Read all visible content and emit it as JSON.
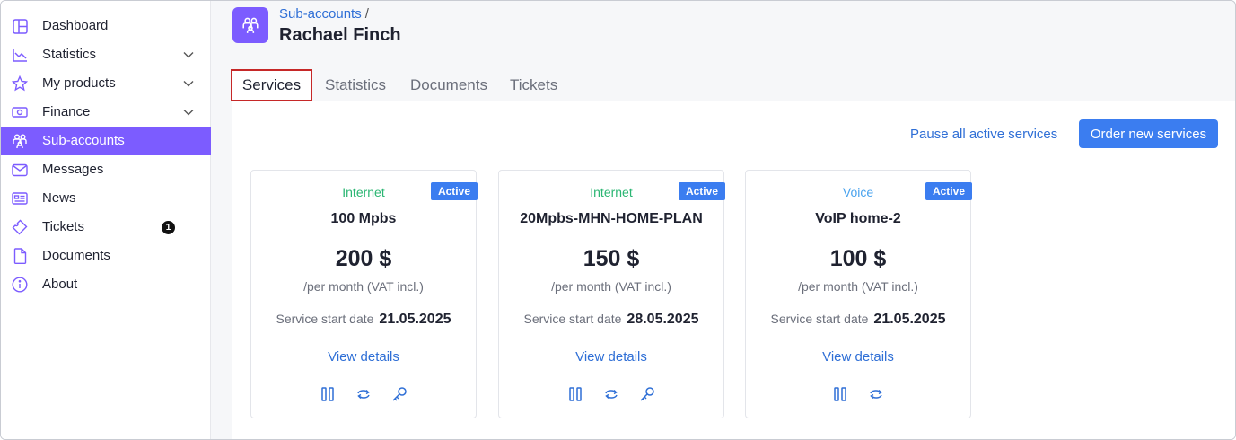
{
  "sidebar": {
    "items": [
      {
        "label": "Dashboard",
        "icon": "dashboard-icon"
      },
      {
        "label": "Statistics",
        "icon": "chart-icon",
        "has_children": true
      },
      {
        "label": "My products",
        "icon": "star-icon",
        "has_children": true
      },
      {
        "label": "Finance",
        "icon": "money-icon",
        "has_children": true
      },
      {
        "label": "Sub-accounts",
        "icon": "users-icon",
        "active": true
      },
      {
        "label": "Messages",
        "icon": "mail-icon"
      },
      {
        "label": "News",
        "icon": "news-icon"
      },
      {
        "label": "Tickets",
        "icon": "ticket-icon",
        "badge": "1"
      },
      {
        "label": "Documents",
        "icon": "document-icon"
      },
      {
        "label": "About",
        "icon": "info-icon"
      }
    ]
  },
  "header": {
    "breadcrumb": "Sub-accounts",
    "separator": "/",
    "title": "Rachael Finch"
  },
  "tabs": [
    {
      "label": "Services",
      "active": true
    },
    {
      "label": "Statistics"
    },
    {
      "label": "Documents"
    },
    {
      "label": "Tickets"
    }
  ],
  "toolbar": {
    "pause_all_label": "Pause all active services",
    "order_new_label": "Order new services"
  },
  "cards": [
    {
      "category": "Internet",
      "category_color": "#2bb673",
      "status": "Active",
      "name": "100 Mpbs",
      "price": "200 $",
      "period": "/per month (VAT incl.)",
      "start_label": "Service start date",
      "start_date": "21.05.2025",
      "details_label": "View details",
      "actions": [
        "pause-icon",
        "refresh-icon",
        "key-icon"
      ]
    },
    {
      "category": "Internet",
      "category_color": "#2bb673",
      "status": "Active",
      "name": "20Mpbs-MHN-HOME-PLAN",
      "price": "150 $",
      "period": "/per month (VAT incl.)",
      "start_label": "Service start date",
      "start_date": "28.05.2025",
      "details_label": "View details",
      "actions": [
        "pause-icon",
        "refresh-icon",
        "key-icon"
      ]
    },
    {
      "category": "Voice",
      "category_color": "#4aa3ee",
      "status": "Active",
      "name": "VoIP home-2",
      "price": "100 $",
      "period": "/per month (VAT incl.)",
      "start_label": "Service start date",
      "start_date": "21.05.2025",
      "details_label": "View details",
      "actions": [
        "pause-icon",
        "refresh-icon"
      ]
    }
  ],
  "colors": {
    "accent": "#7c5cff",
    "primary": "#3b7df0",
    "link": "#2f6fd6",
    "highlight_border": "#c62828"
  }
}
